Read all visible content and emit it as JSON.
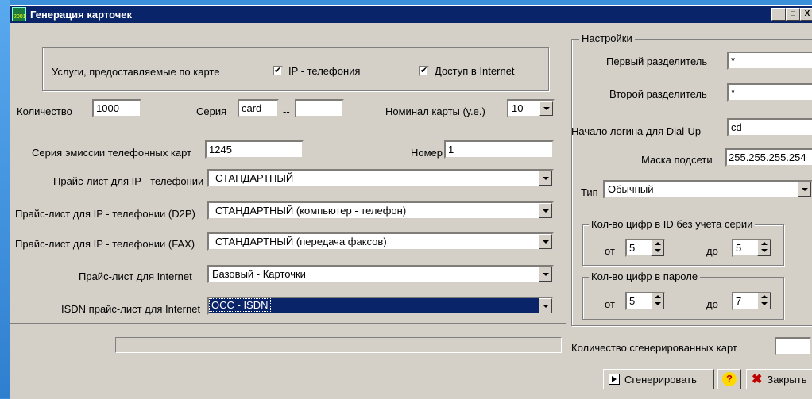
{
  "window": {
    "title": "Генерация карточек",
    "icon_text": "2001"
  },
  "services": {
    "label": "Услуги, предоставляемые по карте",
    "ip_telephony": {
      "label": "IP - телефония",
      "checked": true
    },
    "internet": {
      "label": "Доступ в Internet",
      "checked": true
    }
  },
  "quantity": {
    "label": "Количество",
    "value": "1000"
  },
  "series": {
    "label": "Серия",
    "value": "card",
    "dash": "--",
    "value2": ""
  },
  "nominal": {
    "label": "Номинал карты (у.е.)",
    "value": "10"
  },
  "emission": {
    "label": "Серия эмиссии телефонных карт",
    "value": "1245"
  },
  "number": {
    "label": "Номер",
    "value": "1"
  },
  "pricelists": {
    "ip": {
      "label": "Прайс-лист для IP - телефонии",
      "value": "СТАНДАРТНЫЙ"
    },
    "d2p": {
      "label": "Прайс-лист для IP - телефонии (D2P)",
      "value": "СТАНДАРТНЫЙ (компьютер - телефон)"
    },
    "fax": {
      "label": "Прайс-лист для IP - телефонии (FAX)",
      "value": "СТАНДАРТНЫЙ (передача факсов)"
    },
    "internet": {
      "label": "Прайс-лист для Internet",
      "value": "Базовый - Карточки"
    },
    "isdn": {
      "label": "ISDN прайс-лист для Internet",
      "value": "ОСС - ISDN"
    }
  },
  "settings": {
    "group_label": "Настройки",
    "sep1": {
      "label": "Первый разделитель",
      "value": "*"
    },
    "sep2": {
      "label": "Второй разделитель",
      "value": "*"
    },
    "login_start": {
      "label": "Начало логина для Dial-Up",
      "value": "cd"
    },
    "subnet": {
      "label": "Маска подсети",
      "value": "255.255.255.254"
    },
    "type": {
      "label": "Тип",
      "value": "Обычный"
    },
    "id_digits": {
      "group_label": "Кол-во цифр в ID без учета серии",
      "from_label": "от",
      "from": "5",
      "to_label": "до",
      "to": "5"
    },
    "pwd_digits": {
      "group_label": "Кол-во цифр в пароле",
      "from_label": "от",
      "from": "5",
      "to_label": "до",
      "to": "7"
    }
  },
  "generated": {
    "label": "Количество сгенерированных карт",
    "value": ""
  },
  "buttons": {
    "generate": "Сгенерировать",
    "help": "?",
    "close": "Закрыть"
  },
  "colors": {
    "titlebar": "#0a246a",
    "face": "#d4d0c8",
    "desktop": "#3a8fd8"
  }
}
